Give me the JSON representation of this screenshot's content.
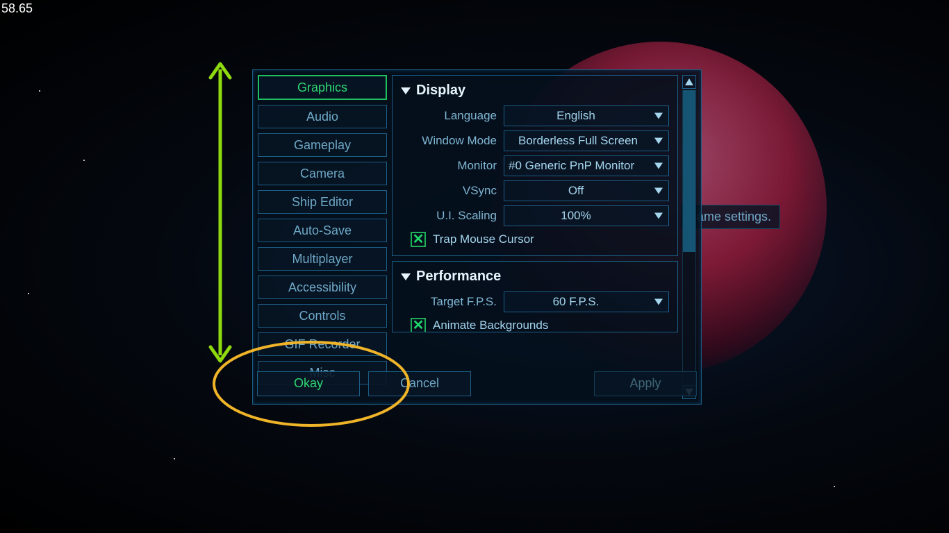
{
  "fps": "58.65",
  "tooltip": "game settings.",
  "sidebar": {
    "tabs": [
      {
        "label": "Graphics",
        "active": true
      },
      {
        "label": "Audio"
      },
      {
        "label": "Gameplay"
      },
      {
        "label": "Camera"
      },
      {
        "label": "Ship Editor"
      },
      {
        "label": "Auto-Save"
      },
      {
        "label": "Multiplayer"
      },
      {
        "label": "Accessibility"
      },
      {
        "label": "Controls"
      },
      {
        "label": "GIF Recorder"
      },
      {
        "label": "Misc"
      }
    ]
  },
  "display": {
    "title": "Display",
    "language_label": "Language",
    "language_value": "English",
    "windowmode_label": "Window Mode",
    "windowmode_value": "Borderless Full Screen",
    "monitor_label": "Monitor",
    "monitor_value": "#0 Generic PnP Monitor",
    "vsync_label": "VSync",
    "vsync_value": "Off",
    "uiscale_label": "U.I. Scaling",
    "uiscale_value": "100%",
    "trap_label": "Trap Mouse Cursor",
    "trap_checked": true
  },
  "performance": {
    "title": "Performance",
    "targetfps_label": "Target F.P.S.",
    "targetfps_value": "60 F.P.S.",
    "animate_label": "Animate Backgrounds",
    "animate_checked": true
  },
  "buttons": {
    "okay": "Okay",
    "cancel": "Cancel",
    "apply": "Apply"
  },
  "colors": {
    "accent_green": "#2fd873",
    "border_blue": "#1b5e86",
    "text_blue": "#a5d6ee",
    "annotation_green": "#8fd90f",
    "annotation_orange": "#f0b429"
  }
}
